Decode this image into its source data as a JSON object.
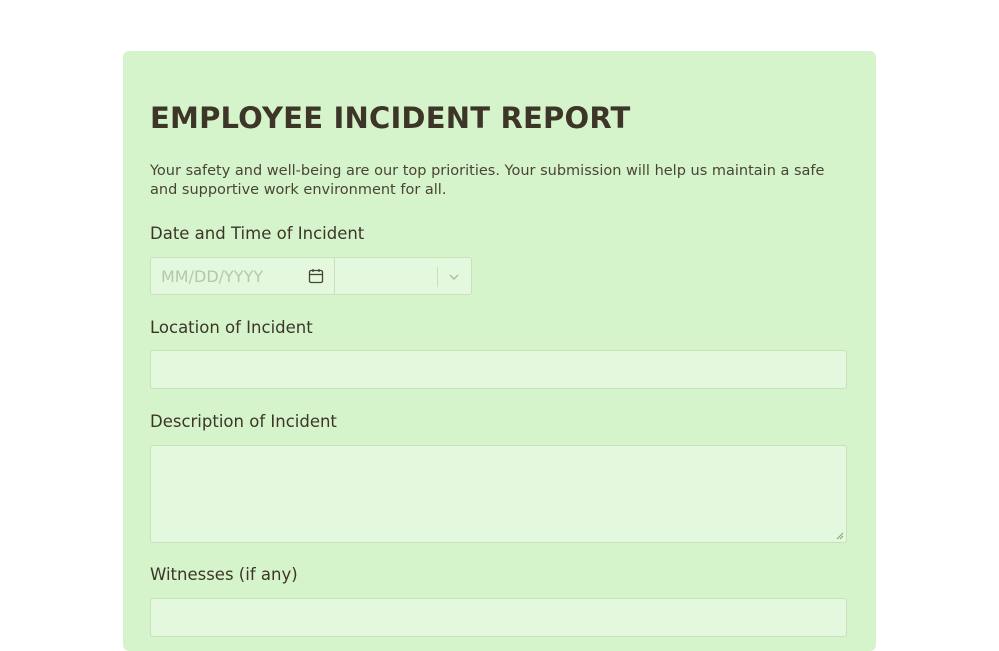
{
  "form": {
    "title": "EMPLOYEE INCIDENT REPORT",
    "description": "Your safety and well-being are our top priorities. Your submission will help us maintain a safe and supportive work environment for all.",
    "fields": {
      "datetime": {
        "label": "Date and Time of Incident",
        "date_placeholder": "MM/DD/YYYY",
        "time_value": ""
      },
      "location": {
        "label": "Location of Incident",
        "value": ""
      },
      "description": {
        "label": "Description of Incident",
        "value": ""
      },
      "witnesses": {
        "label": "Witnesses (if any)",
        "value": ""
      }
    }
  },
  "icons": {
    "calendar": "calendar-icon",
    "chevron": "chevron-down-icon"
  },
  "colors": {
    "card_background": "#d5f4cb",
    "field_background": "#e4f8dd",
    "text": "#3d3628"
  }
}
